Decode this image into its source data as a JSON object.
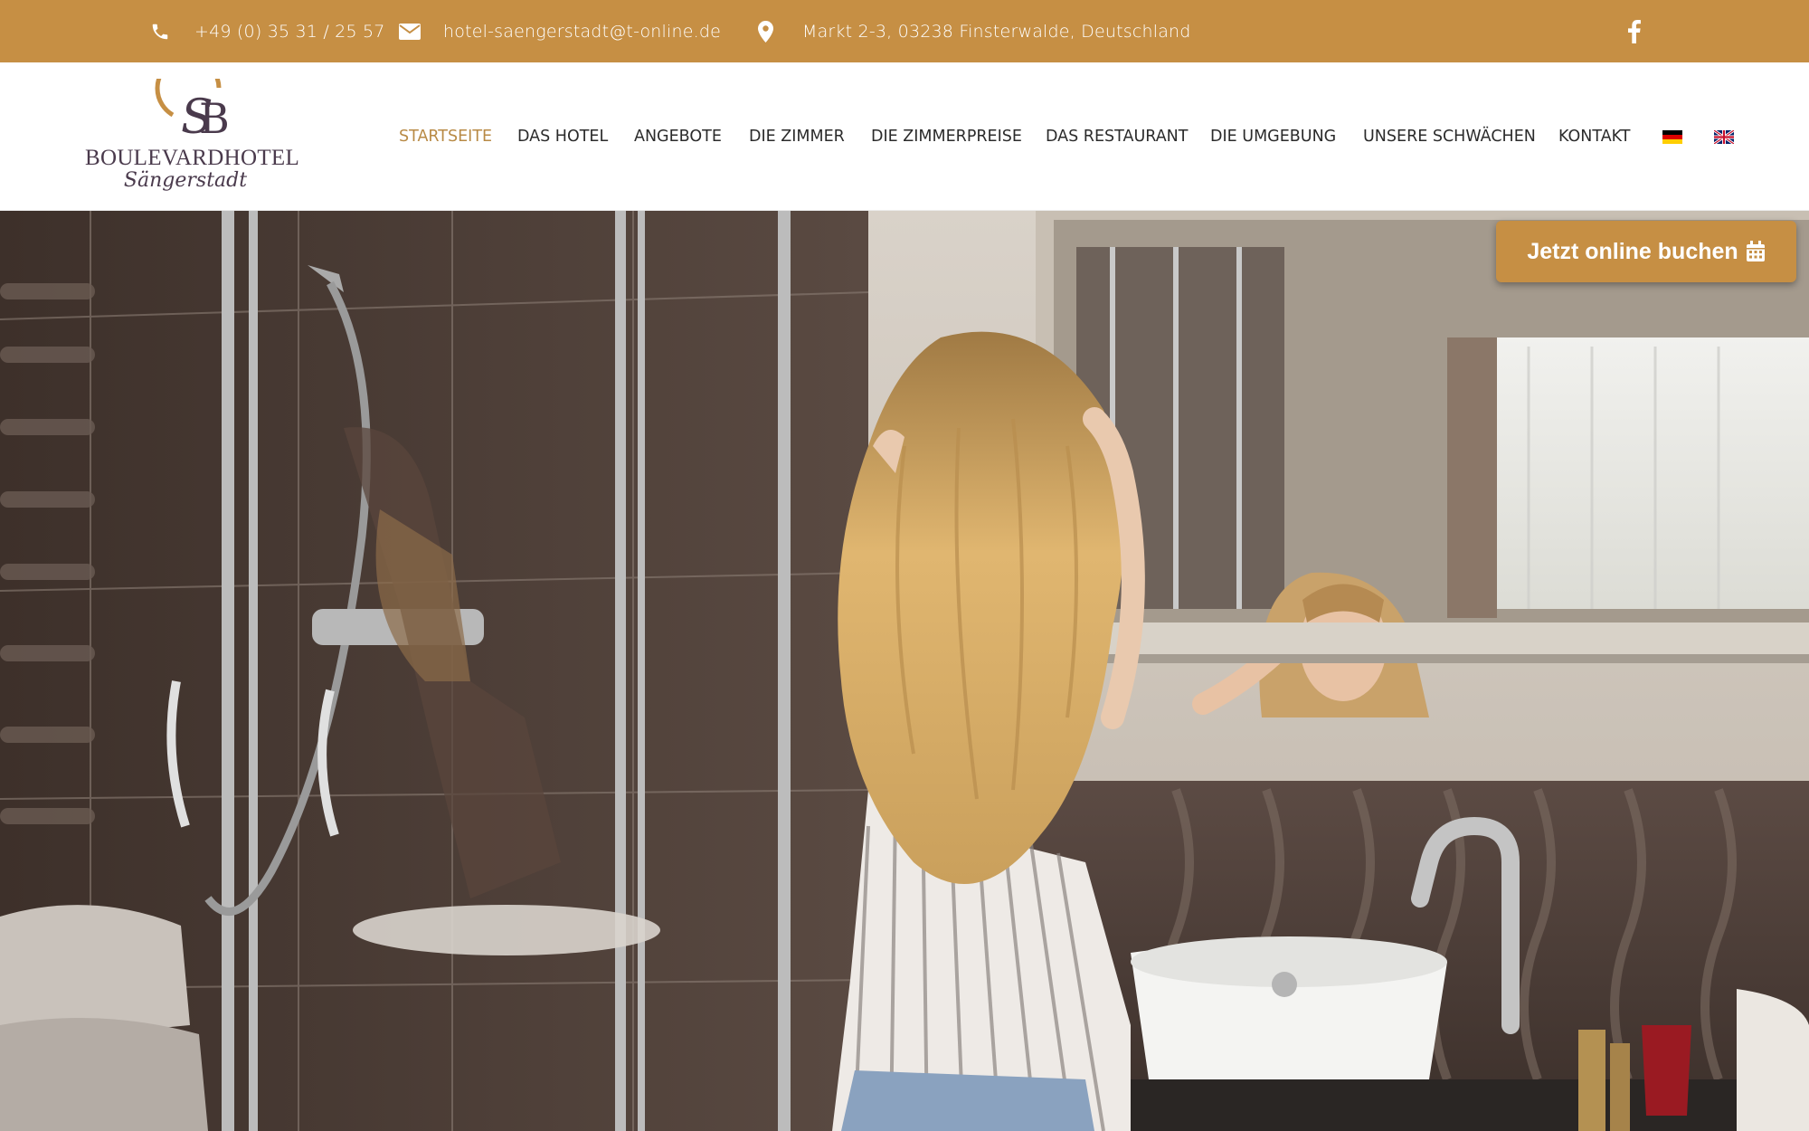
{
  "topbar": {
    "phone": "+49 (0) 35 31 / 25 57",
    "email": "hotel-saengerstadt@t-online.de",
    "address": "Markt 2-3, 03238 Finsterwalde, Deutschland",
    "icons": [
      "phone-icon",
      "envelope-icon",
      "map-marker-icon",
      "facebook-icon"
    ]
  },
  "logo": {
    "monogram": "SB",
    "wordmark": "BOULEVARDHOTEL",
    "script": "Sängerstadt"
  },
  "nav": {
    "items": [
      {
        "label": "STARTSEITE",
        "active": true
      },
      {
        "label": "DAS HOTEL",
        "active": false
      },
      {
        "label": "ANGEBOTE",
        "active": false
      },
      {
        "label": "DIE ZIMMER",
        "active": false
      },
      {
        "label": "DIE ZIMMERPREISE",
        "active": false
      },
      {
        "label": "DAS RESTAURANT",
        "active": false
      },
      {
        "label": "DIE UMGEBUNG",
        "active": false
      },
      {
        "label": "UNSERE SCHWÄCHEN",
        "active": false
      },
      {
        "label": "KONTAKT",
        "active": false
      }
    ],
    "languages": [
      "de-flag-icon",
      "en-flag-icon"
    ]
  },
  "hero": {
    "cta_label": "Jetzt online buchen",
    "cta_icon": "calendar-icon"
  },
  "colors": {
    "brand": "#c68f44",
    "nav_active": "#b88a45",
    "nav_text": "#2b2b2b"
  }
}
